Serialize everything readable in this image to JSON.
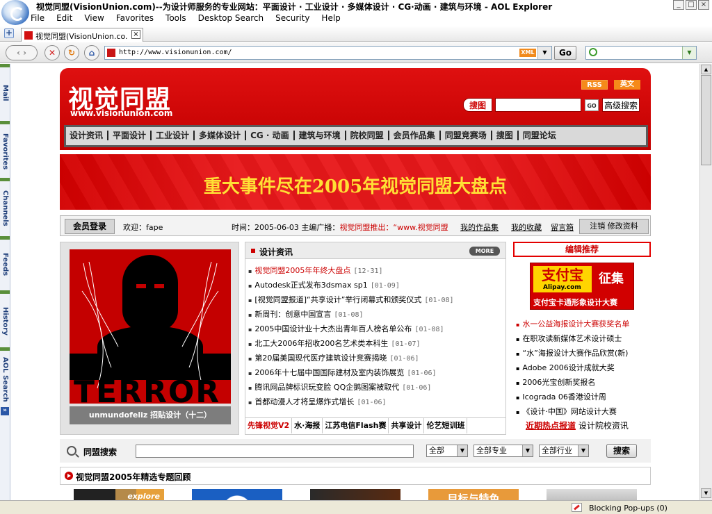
{
  "window": {
    "title": "视觉同盟(VisionUnion.com)--为设计师服务的专业网站：平面设计 · 工业设计 · 多媒体设计 · CG·动画 · 建筑与环境 - AOL Explorer",
    "controls": [
      "_",
      "□",
      "×"
    ]
  },
  "menu": [
    "File",
    "Edit",
    "View",
    "Favorites",
    "Tools",
    "Desktop Search",
    "Security",
    "Help"
  ],
  "tab": {
    "title": "视觉同盟(VisionUnion.co...",
    "close": "×",
    "new": "+"
  },
  "address": {
    "url": "http://www.visionunion.com/",
    "feed_badge": "XML",
    "go_label": "Go",
    "dropdown": "▼"
  },
  "search": {
    "placeholder": "",
    "dropdown": "▼"
  },
  "sidebar": [
    "Mail",
    "Favorites",
    "Channels",
    "Feeds",
    "History",
    "AOL Search"
  ],
  "sidebar_toggle": "»",
  "scrollbar": {
    "up": "▲",
    "down": "▼"
  },
  "status": {
    "popup": "Blocking Pop-ups (0)"
  },
  "site": {
    "logo": "视觉同盟",
    "logo_url": "www.visionunion.com",
    "rss": "RSS",
    "english": "英文",
    "search_btn": "搜图",
    "search_go": "GO",
    "adv_search": "高级搜索",
    "nav": [
      "设计资讯",
      "平面设计",
      "工业设计",
      "多媒体设计",
      "CG · 动画",
      "建筑与环境",
      "院校同盟",
      "会员作品集",
      "同盟竞赛场",
      "搜图",
      "同盟论坛"
    ],
    "banner": "重大事件尽在2005年视觉同盟大盘点",
    "member": {
      "login": "会员登录",
      "welcome": "欢迎：fape",
      "time_label": "时间：2005-06-03  主编广播：",
      "broadcast": "视觉同盟推出：“www.视觉同盟",
      "links": [
        "我的作品集",
        "我的收藏",
        "留言箱"
      ],
      "options": "注销  修改资料"
    },
    "feature": {
      "image_text": "TERROR",
      "caption": "unmundofeliz 招贴设计（十二）"
    },
    "news": {
      "title": "设计资讯",
      "more": "MORE",
      "items": [
        {
          "t": "视觉同盟2005年年终大盘点",
          "d": "[12-31]"
        },
        {
          "t": "Autodesk正式发布3dsmax sp1",
          "d": "[01-09]"
        },
        {
          "t": "[视觉同盟报道]“共享设计”举行闭幕式和颁奖仪式",
          "d": "[01-08]"
        },
        {
          "t": "新周刊：创意中国宣言",
          "d": "[01-08]"
        },
        {
          "t": "2005中国设计业十大杰出青年百人榜名单公布",
          "d": "[01-08]"
        },
        {
          "t": "北工大2006年招收200名艺术类本科生",
          "d": "[01-07]"
        },
        {
          "t": "第20届美国现代医疗建筑设计竞赛揭晓",
          "d": "[01-06]"
        },
        {
          "t": "2006年十七届中国国际建材及室内装饰展览",
          "d": "[01-06]"
        },
        {
          "t": "腾讯网品牌标识玩变脸 QQ企鹅图案被取代",
          "d": "[01-06]"
        },
        {
          "t": "首都动漫人才将呈爆炸式增长",
          "d": "[01-06]"
        }
      ],
      "tabs": [
        "先锋视觉V2",
        "水·海报",
        "江苏电信Flash赛",
        "共享设计",
        "伦艺短训班"
      ]
    },
    "editor": {
      "title": "编辑推荐",
      "ad_brand": "支付宝",
      "ad_brand_en": "Alipay.com",
      "ad_call": "征集",
      "ad_line": "支付宝卡通形象设计大赛",
      "items": [
        "水一公益海报设计大赛获奖名单",
        "在职攻读新媒体艺术设计硕士",
        "“水”海报设计大赛作品欣赏(新)",
        "Adobe 2006设计成就大奖",
        "2006光宝创新奖报名",
        "Icograda 06香港设计周",
        "《设计·中国》网站设计大赛"
      ],
      "hot_label": "近期热点报道",
      "hot_text": "设计院校资讯"
    },
    "alliance_search": {
      "label": "同盟搜索",
      "select1": "全部",
      "select2": "全部专业",
      "select3": "全部行业",
      "button": "搜索"
    },
    "review": {
      "title": "视觉同盟2005年精选专题回顾",
      "thumb4": "目标与特色",
      "thumb1": "explore"
    }
  }
}
